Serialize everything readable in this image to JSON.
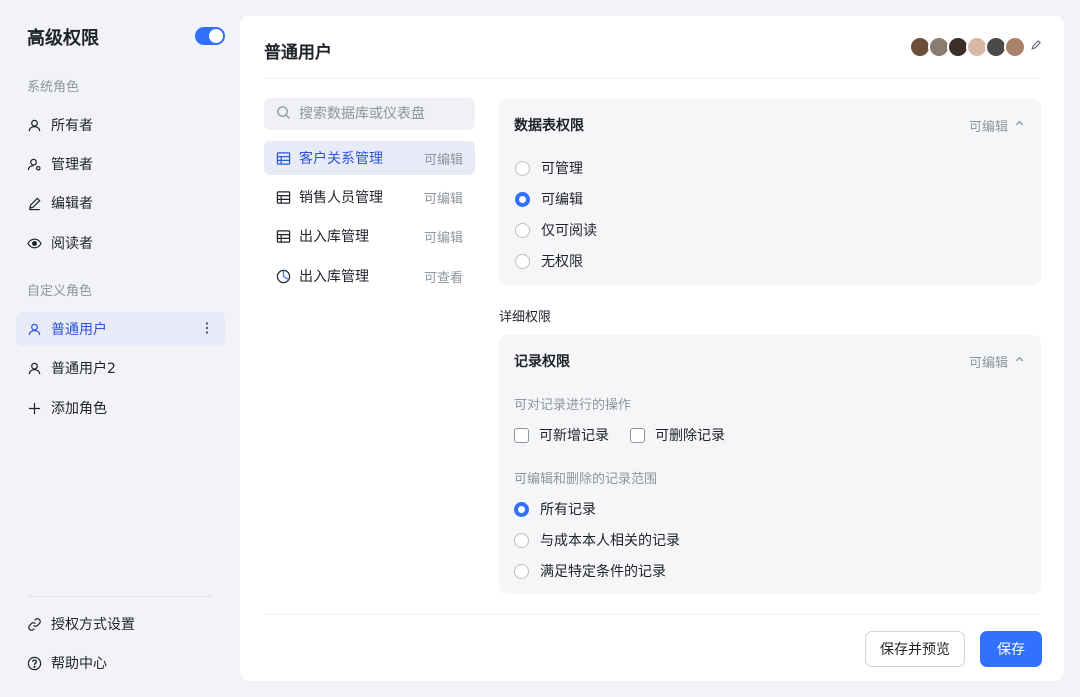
{
  "sidebar": {
    "title": "高级权限",
    "toggle_on": true,
    "system_section": "系统角色",
    "system_roles": [
      {
        "label": "所有者",
        "icon": "user-icon"
      },
      {
        "label": "管理者",
        "icon": "user-gear-icon"
      },
      {
        "label": "编辑者",
        "icon": "pencil-icon"
      },
      {
        "label": "阅读者",
        "icon": "eye-icon"
      }
    ],
    "custom_section": "自定义角色",
    "custom_roles": [
      {
        "label": "普通用户",
        "icon": "user-icon",
        "active": true
      },
      {
        "label": "普通用户2",
        "icon": "user-icon"
      }
    ],
    "add_role": "添加角色",
    "auth_settings": "授权方式设置",
    "help_center": "帮助中心"
  },
  "main": {
    "title": "普通用户",
    "search_placeholder": "搜索数据库或仪表盘",
    "databases": [
      {
        "label": "客户关系管理",
        "perm": "可编辑",
        "icon": "table-icon",
        "active": true
      },
      {
        "label": "销售人员管理",
        "perm": "可编辑",
        "icon": "table-icon"
      },
      {
        "label": "出入库管理",
        "perm": "可编辑",
        "icon": "table-icon"
      },
      {
        "label": "出入库管理",
        "perm": "可查看",
        "icon": "dashboard-icon"
      }
    ],
    "table_panel": {
      "title": "数据表权限",
      "perm": "可编辑",
      "options": [
        "可管理",
        "可编辑",
        "仅可阅读",
        "无权限"
      ],
      "selected": 1
    },
    "detail_label": "详细权限",
    "record_panel": {
      "title": "记录权限",
      "perm": "可编辑",
      "ops_label": "可对记录进行的操作",
      "ops": [
        "可新增记录",
        "可删除记录"
      ],
      "scope_label": "可编辑和删除的记录范围",
      "scope_options": [
        "所有记录",
        "与成本本人相关的记录",
        "满足特定条件的记录"
      ],
      "scope_selected": 0
    },
    "buttons": {
      "save_preview": "保存并预览",
      "save": "保存"
    }
  },
  "colors": {
    "accent": "#3370ff",
    "active_bg": "#e8ebf7",
    "muted": "#8f959e"
  }
}
